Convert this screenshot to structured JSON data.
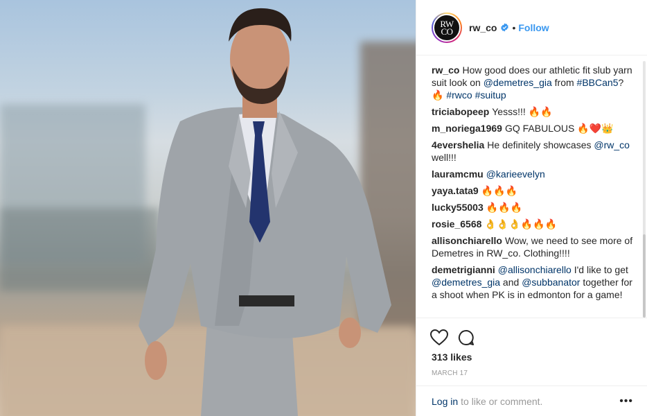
{
  "post": {
    "username": "rw_co",
    "avatar_text_top": "RW",
    "avatar_text_bottom": "CO",
    "dot": "•",
    "follow_label": "Follow",
    "verified_icon": "verified-badge-icon",
    "image_description_icon": "photo-man-in-grey-suit"
  },
  "comments": [
    {
      "user": "rw_co",
      "parts": [
        {
          "t": "text",
          "v": "How good does our athletic fit slub yarn suit look on "
        },
        {
          "t": "link",
          "v": "@demetres_gia"
        },
        {
          "t": "text",
          "v": " from "
        },
        {
          "t": "link",
          "v": "#BBCan5"
        },
        {
          "t": "text",
          "v": "? 🔥 "
        },
        {
          "t": "link",
          "v": "#rwco"
        },
        {
          "t": "text",
          "v": " "
        },
        {
          "t": "link",
          "v": "#suitup"
        }
      ]
    },
    {
      "user": "triciabopeep",
      "parts": [
        {
          "t": "text",
          "v": "Yesss!!! 🔥🔥"
        }
      ]
    },
    {
      "user": "m_noriega1969",
      "parts": [
        {
          "t": "text",
          "v": "GQ FABULOUS 🔥❤️👑"
        }
      ]
    },
    {
      "user": "4evershelia",
      "parts": [
        {
          "t": "text",
          "v": "He definitely showcases "
        },
        {
          "t": "link",
          "v": "@rw_co"
        },
        {
          "t": "text",
          "v": " well!!!"
        }
      ]
    },
    {
      "user": "lauramcmu",
      "parts": [
        {
          "t": "link",
          "v": "@karieevelyn"
        }
      ]
    },
    {
      "user": "yaya.tata9",
      "parts": [
        {
          "t": "text",
          "v": "🔥🔥🔥"
        }
      ]
    },
    {
      "user": "lucky55003",
      "parts": [
        {
          "t": "text",
          "v": "🔥🔥🔥"
        }
      ]
    },
    {
      "user": "rosie_6568",
      "parts": [
        {
          "t": "text",
          "v": "👌👌👌🔥🔥🔥"
        }
      ]
    },
    {
      "user": "allisonchiarello",
      "parts": [
        {
          "t": "text",
          "v": "Wow, we need to see more of Demetres in RW_co. Clothing!!!!"
        }
      ]
    },
    {
      "user": "demetrigianni",
      "parts": [
        {
          "t": "link",
          "v": "@allisonchiarello"
        },
        {
          "t": "text",
          "v": " I'd like to get "
        },
        {
          "t": "link",
          "v": "@demetres_gia"
        },
        {
          "t": "text",
          "v": " and "
        },
        {
          "t": "link",
          "v": "@subbanator"
        },
        {
          "t": "text",
          "v": " together for a shoot when PK is in edmonton for a game!"
        }
      ]
    }
  ],
  "actions": {
    "like_icon": "heart-icon",
    "comment_icon": "comment-bubble-icon",
    "likes_text": "313 likes",
    "date_text": "MARCH 17"
  },
  "footer": {
    "login_label": "Log in",
    "rest_text": "to like or comment.",
    "more_label": "•••",
    "more_icon": "more-options-icon"
  },
  "colors": {
    "link": "#003569",
    "follow": "#3897f0",
    "verified": "#3897f0",
    "muted": "#999999",
    "text": "#262626"
  }
}
